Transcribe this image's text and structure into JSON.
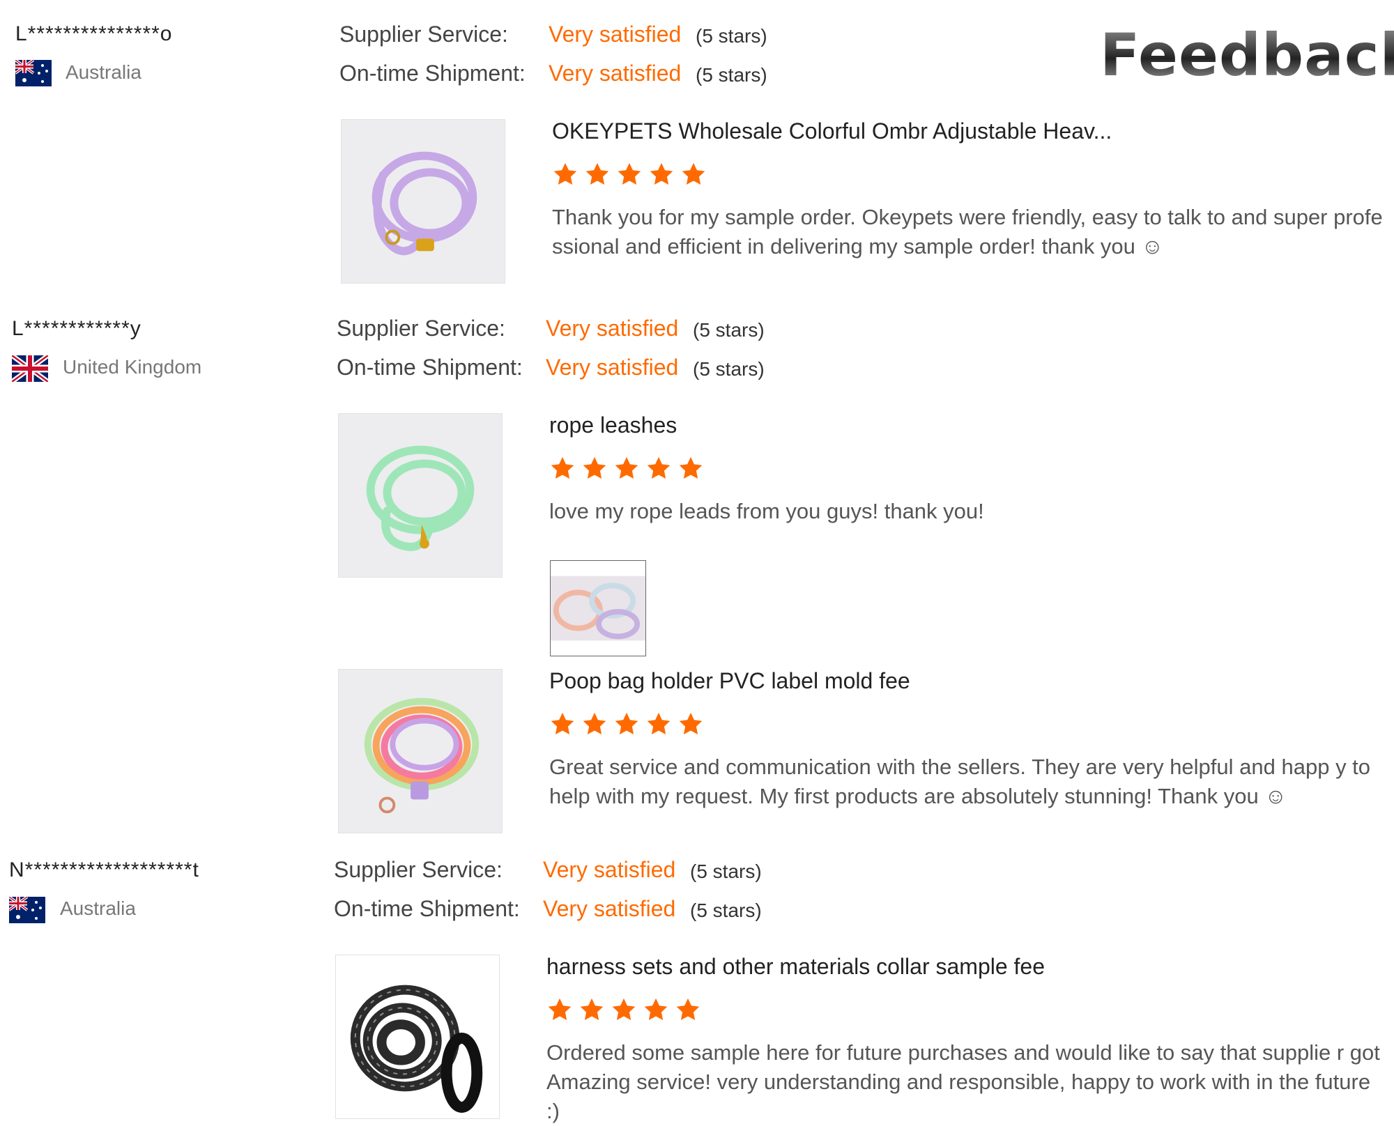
{
  "header": {
    "title": "Feedback"
  },
  "colors": {
    "accent": "#ff6a00",
    "star": "#ff6a00"
  },
  "reviews": [
    {
      "user": "L***************o",
      "country": "Australia",
      "flag_icon": "australia-flag-icon",
      "supplier_service_label": "Supplier Service:",
      "supplier_service_value": "Very satisfied",
      "supplier_service_stars": "(5 stars)",
      "shipment_label": "On-time Shipment:",
      "shipment_value": "Very satisfied",
      "shipment_stars": "(5 stars)",
      "items": [
        {
          "product": "OKEYPETS Wholesale Colorful Ombr Adjustable Heav...",
          "rating": 5,
          "text": "Thank you for my sample order. Okeypets were friendly, easy to talk to and super professional and efficient in delivering my sample order! thank you ☺"
        }
      ]
    },
    {
      "user": "L************y",
      "country": "United Kingdom",
      "flag_icon": "united-kingdom-flag-icon",
      "supplier_service_label": "Supplier Service:",
      "supplier_service_value": "Very satisfied",
      "supplier_service_stars": "(5 stars)",
      "shipment_label": "On-time Shipment:",
      "shipment_value": "Very satisfied",
      "shipment_stars": "(5 stars)",
      "items": [
        {
          "product": "rope leashes",
          "rating": 5,
          "text": "love my rope leads from you guys! thank you!"
        },
        {
          "product": "Poop bag holder PVC label mold fee",
          "rating": 5,
          "text": "Great service and communication with the sellers. They are very helpful and happ y to help with my request. My first products are absolutely stunning! Thank you ☺"
        }
      ]
    },
    {
      "user": "N*******************t",
      "country": "Australia",
      "flag_icon": "australia-flag-icon",
      "supplier_service_label": "Supplier Service:",
      "supplier_service_value": "Very satisfied",
      "supplier_service_stars": "(5 stars)",
      "shipment_label": "On-time Shipment:",
      "shipment_value": "Very satisfied",
      "shipment_stars": "(5 stars)",
      "items": [
        {
          "product": "harness sets and other materials collar sample fee",
          "rating": 5,
          "text": "Ordered some sample here for future purchases and would like to say that supplie r got Amazing service! very understanding and responsible, happy to work with in the future :)"
        }
      ]
    }
  ]
}
